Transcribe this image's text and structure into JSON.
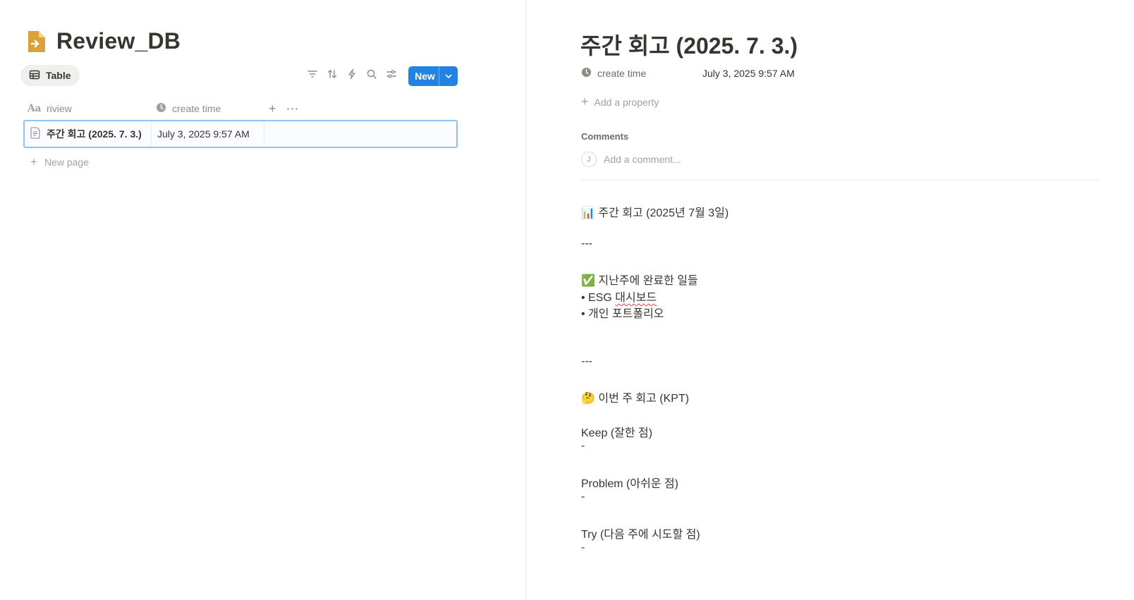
{
  "database": {
    "title": "Review_DB",
    "view_tab": "Table",
    "new_button": "New",
    "columns": [
      {
        "label": "riview",
        "type_glyph": "Aa"
      },
      {
        "label": "create time"
      }
    ],
    "rows": [
      {
        "title": "주간 회고 (2025. 7. 3.)",
        "create_time": "July 3, 2025 9:57 AM"
      }
    ],
    "new_page": "New page"
  },
  "page": {
    "title": "주간 회고 (2025. 7. 3.)",
    "property": {
      "name": "create time",
      "value": "July 3, 2025 9:57 AM"
    },
    "add_property": "Add a property",
    "comments_label": "Comments",
    "avatar_initial": "J",
    "comment_placeholder": "Add a comment...",
    "lines": {
      "l1": "📊 주간 회고 (2025년 7월 3일)",
      "l2": "---",
      "l3": "✅ 지난주에 완료한 일들",
      "l4_prefix": "• ESG ",
      "l4_word": "대시보드",
      "l5": "• 개인 포트폴리오",
      "l6": "---",
      "l7": "🤔 이번 주 회고 (KPT)",
      "l8": "Keep (잘한 점)",
      "l9": "-",
      "l10": "Problem (아쉬운 점)",
      "l11": "-",
      "l12": "Try (다음 주에 시도할 점)",
      "l13": "-"
    }
  },
  "colors": {
    "accent": "#2383e2",
    "db_icon": "#d9a339",
    "selected_border": "#8fc4ef",
    "text": "#37352f",
    "muted": "#a3a19c"
  }
}
